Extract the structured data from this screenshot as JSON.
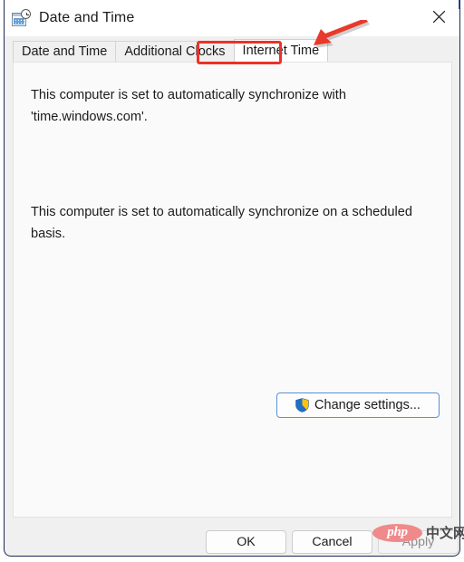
{
  "window": {
    "title": "Date and Time",
    "icon": "calendar-clock-icon",
    "close_label": "✕"
  },
  "tabs": [
    {
      "label": "Date and Time",
      "selected": false
    },
    {
      "label": "Additional Clocks",
      "selected": false
    },
    {
      "label": "Internet Time",
      "selected": true
    }
  ],
  "content": {
    "paragraph_1": "This computer is set to automatically synchronize with 'time.windows.com'.",
    "paragraph_2": "This computer is set to automatically synchronize on a scheduled basis.",
    "change_settings_label": "Change settings...",
    "change_settings_icon": "uac-shield-icon"
  },
  "footer": {
    "ok_label": "OK",
    "cancel_label": "Cancel",
    "apply_label": "Apply",
    "apply_disabled": true
  },
  "annotations": {
    "arrow": "red-arrow-pointing-to-internet-time-tab",
    "highlight": "red-rectangle-around-internet-time-tab",
    "highlight_color": "#ee3124"
  },
  "watermark": {
    "php_text": "php",
    "cn_text": "中文网",
    "badge_color": "#f08a8a"
  },
  "colors": {
    "window_border": "#1d2b53",
    "dialog_background": "#f0f0f0",
    "panel_background": "#fafafa",
    "button_accent": "#5a8fd6",
    "annotation_red": "#ee3124"
  }
}
